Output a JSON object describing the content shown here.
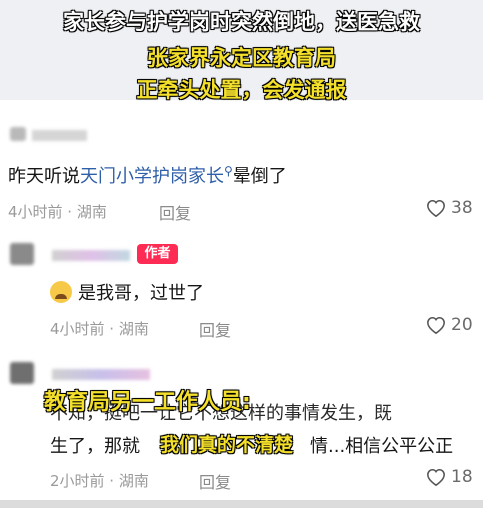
{
  "headline": {
    "line1": "家长参与护学岗时突然倒地，送医急救",
    "line2": "张家界永定区教育局",
    "line3": "正牵头处置，会发通报"
  },
  "comments": [
    {
      "text_before": "昨天听说",
      "link": "天门小学护岗家长",
      "text_after": "晕倒了",
      "meta": "4小时前 · 湖南",
      "reply": "回复",
      "likes": "38"
    },
    {
      "badge": "作者",
      "text": "是我哥，过世了",
      "meta": "4小时前 · 湖南",
      "reply": "回复",
      "likes": "20"
    },
    {
      "line1": "不知，挺吧一让它不想这样的事情发生，既",
      "line2_before": "生了，那就",
      "line2_after": "情...相信公平公正",
      "meta": "2小时前 · 湖南",
      "reply": "回复",
      "likes": "18"
    }
  ],
  "overlay": {
    "label1": "教育局另一工作人员:",
    "label2": "我们真的不清楚"
  },
  "colors": {
    "accent": "#fe2c55",
    "link": "#2f5fa8",
    "caption_yellow": "#f4e02a"
  },
  "icons": [
    "search-icon",
    "heart-icon",
    "crying-emoji-icon"
  ]
}
